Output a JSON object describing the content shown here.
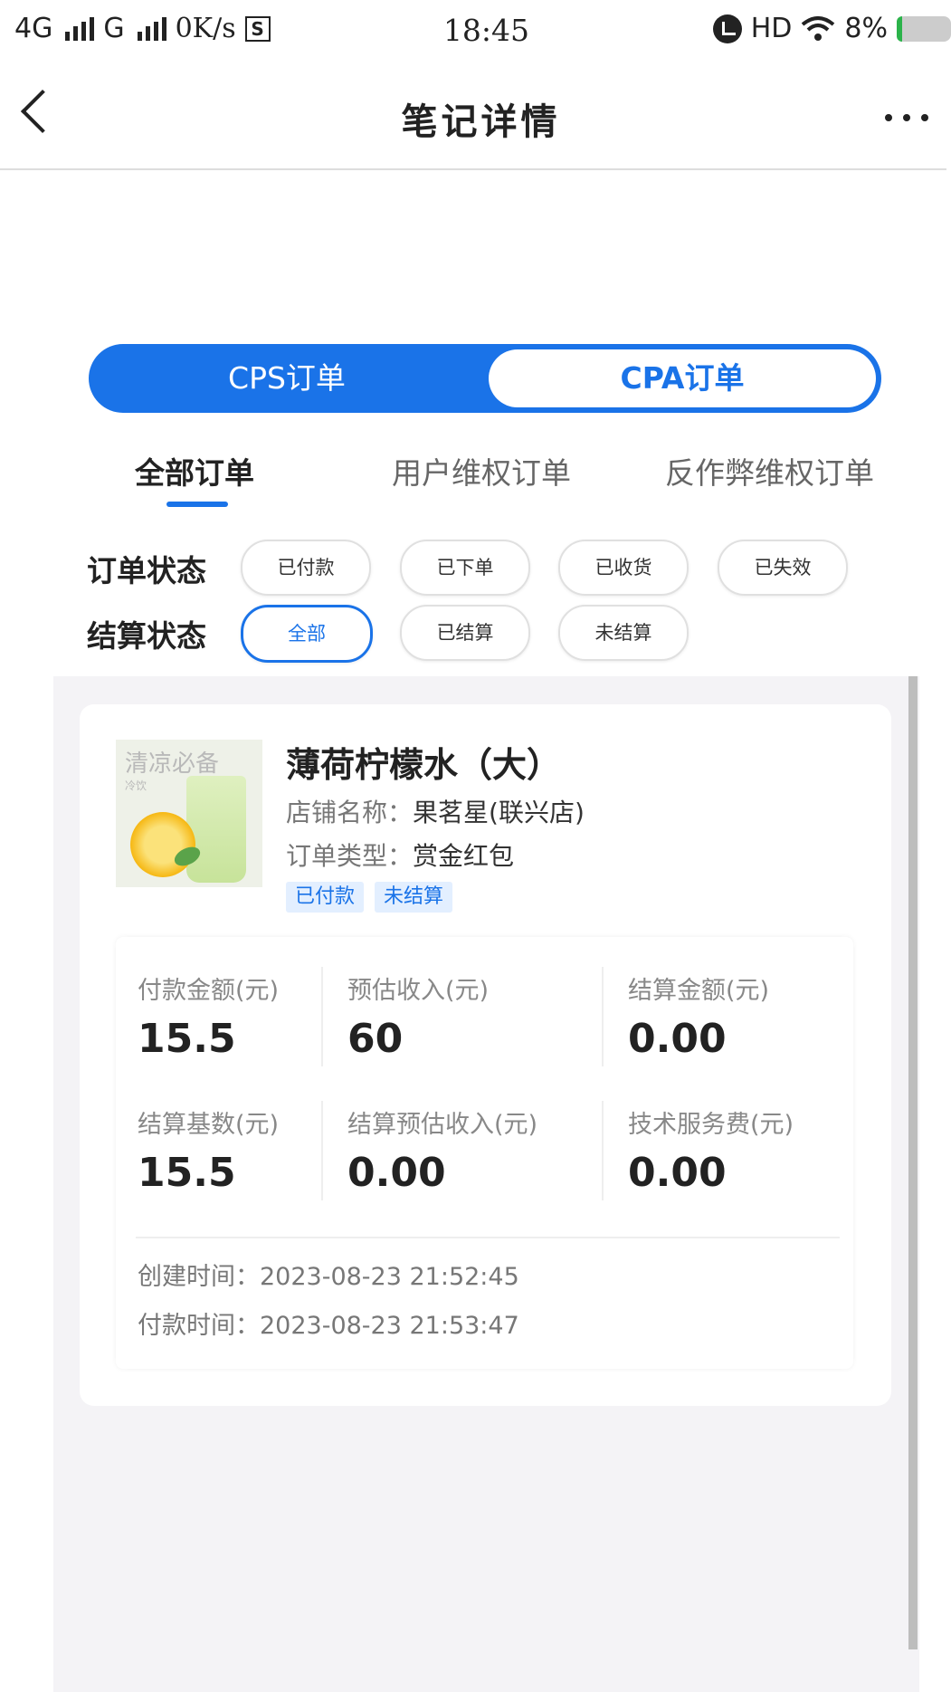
{
  "status_bar": {
    "network1": "4G",
    "network2": "G",
    "speed": "0K/s",
    "s_icon": "S",
    "time": "18:45",
    "hd": "HD",
    "battery": "8%"
  },
  "nav": {
    "title": "笔记详情"
  },
  "segment": {
    "cps_label": "CPS订单",
    "cpa_label": "CPA订单"
  },
  "tabs": [
    "全部订单",
    "用户维权订单",
    "反作弊维权订单"
  ],
  "filters": {
    "order_status_label": "订单状态",
    "order_status_options": [
      "已付款",
      "已下单",
      "已收货",
      "已失效"
    ],
    "settle_status_label": "结算状态",
    "settle_status_options": [
      "全部",
      "已结算",
      "未结算"
    ],
    "selected_settle": "全部"
  },
  "order": {
    "thumb_text": "清凉必备",
    "thumb_sub": "冷饮",
    "title": "薄荷柠檬水（大）",
    "shop_label": "店铺名称：",
    "shop_name": "果茗星(联兴店)",
    "type_label": "订单类型：",
    "type_value": "赏金红包",
    "tags": [
      "已付款",
      "未结算"
    ],
    "stats": [
      {
        "label": "付款金额(元)",
        "value": "15.5"
      },
      {
        "label": "预估收入(元)",
        "value": "60"
      },
      {
        "label": "结算金额(元)",
        "value": "0.00"
      },
      {
        "label": "结算基数(元)",
        "value": "15.5"
      },
      {
        "label": "结算预估收入(元)",
        "value": "0.00"
      },
      {
        "label": "技术服务费(元)",
        "value": "0.00"
      }
    ],
    "created_time": "创建时间：2023-08-23 21:52:45",
    "paid_time": "付款时间：2023-08-23 21:53:47"
  },
  "colors": {
    "accent": "#1a73e8",
    "background": "#f4f3f6"
  }
}
